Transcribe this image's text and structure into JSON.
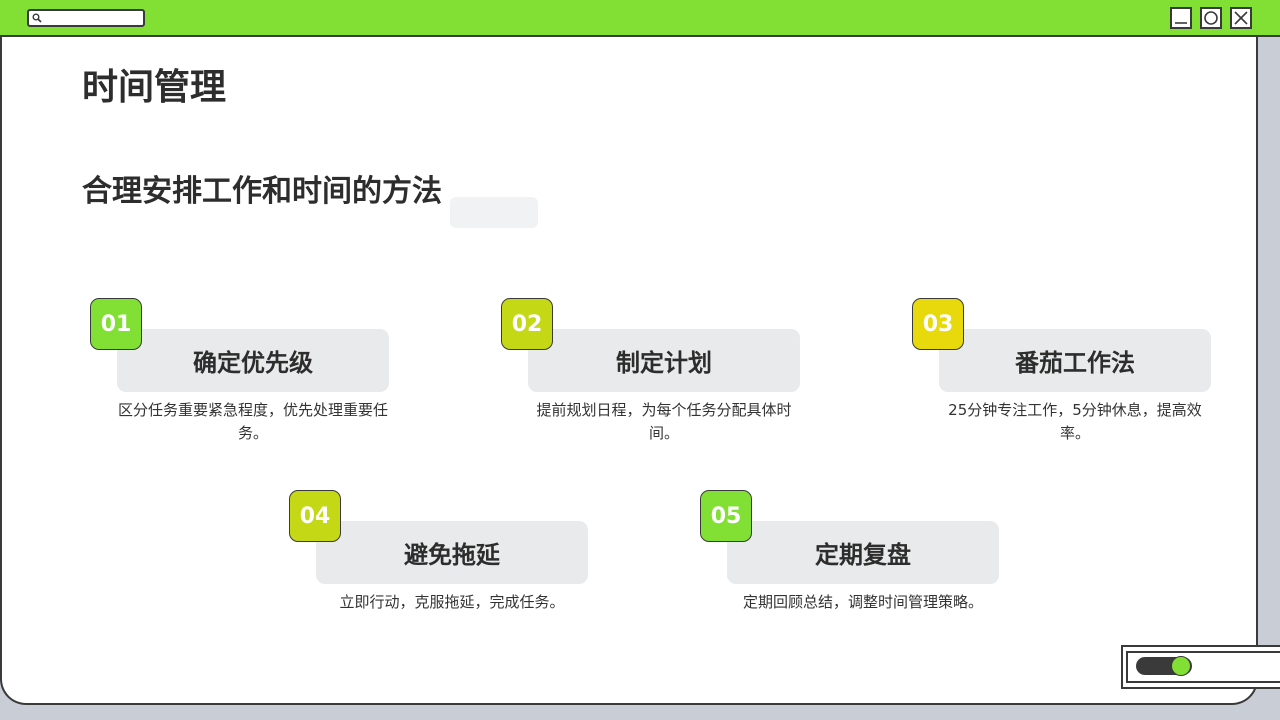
{
  "page": {
    "title": "时间管理",
    "subtitle": "合理安排工作和时间的方法"
  },
  "window": {
    "accent_color": "#82e034",
    "controls": [
      "minimize-icon",
      "maximize-icon",
      "close-icon"
    ],
    "search_icon": "search-icon"
  },
  "steps": [
    {
      "number": "01",
      "label": "确定优先级",
      "desc": "区分任务重要紧急程度，优先处理重要任务。",
      "color": "#82e034"
    },
    {
      "number": "02",
      "label": "制定计划",
      "desc": "提前规划日程，为每个任务分配具体时间。",
      "color": "#c4d815"
    },
    {
      "number": "03",
      "label": "番茄工作法",
      "desc": "25分钟专注工作，5分钟休息，提高效率。",
      "color": "#e8d90c"
    },
    {
      "number": "04",
      "label": "避免拖延",
      "desc": "立即行动，克服拖延，完成任务。",
      "color": "#c4d815"
    },
    {
      "number": "05",
      "label": "定期复盘",
      "desc": "定期回顾总结，调整时间管理策略。",
      "color": "#82e034"
    }
  ],
  "toggle": {
    "state": "on",
    "color": "#82e034"
  }
}
